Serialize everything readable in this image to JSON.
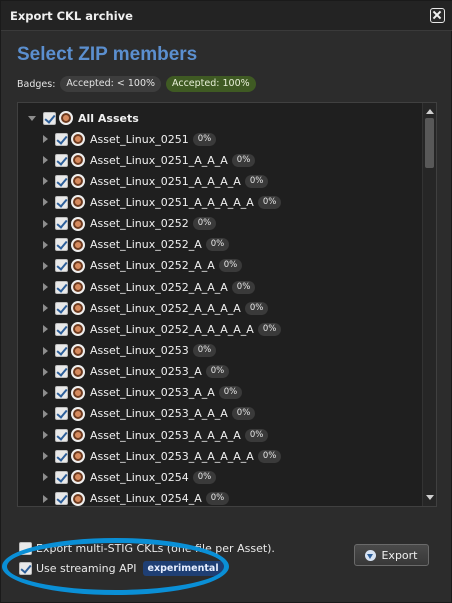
{
  "window": {
    "title": "Export CKL archive"
  },
  "heading": "Select ZIP members",
  "badges": {
    "label": "Badges:",
    "partial": "Accepted: < 100%",
    "full": "Accepted: 100%"
  },
  "tree": {
    "root": {
      "label": "All Assets"
    },
    "items": [
      {
        "label": "Asset_Linux_0251",
        "pct": "0%"
      },
      {
        "label": "Asset_Linux_0251_A_A_A",
        "pct": "0%"
      },
      {
        "label": "Asset_Linux_0251_A_A_A_A",
        "pct": "0%"
      },
      {
        "label": "Asset_Linux_0251_A_A_A_A_A",
        "pct": "0%"
      },
      {
        "label": "Asset_Linux_0252",
        "pct": "0%"
      },
      {
        "label": "Asset_Linux_0252_A",
        "pct": "0%"
      },
      {
        "label": "Asset_Linux_0252_A_A",
        "pct": "0%"
      },
      {
        "label": "Asset_Linux_0252_A_A_A",
        "pct": "0%"
      },
      {
        "label": "Asset_Linux_0252_A_A_A_A",
        "pct": "0%"
      },
      {
        "label": "Asset_Linux_0252_A_A_A_A_A",
        "pct": "0%"
      },
      {
        "label": "Asset_Linux_0253",
        "pct": "0%"
      },
      {
        "label": "Asset_Linux_0253_A",
        "pct": "0%"
      },
      {
        "label": "Asset_Linux_0253_A_A",
        "pct": "0%"
      },
      {
        "label": "Asset_Linux_0253_A_A_A",
        "pct": "0%"
      },
      {
        "label": "Asset_Linux_0253_A_A_A_A",
        "pct": "0%"
      },
      {
        "label": "Asset_Linux_0253_A_A_A_A_A",
        "pct": "0%"
      },
      {
        "label": "Asset_Linux_0254",
        "pct": "0%"
      },
      {
        "label": "Asset_Linux_0254_A",
        "pct": "0%"
      }
    ]
  },
  "options": {
    "multi_stig": {
      "label": "Export multi-STIG CKLs (one file per Asset).",
      "checked": false
    },
    "streaming": {
      "label": "Use streaming API",
      "checked": true,
      "badge": "experimental"
    }
  },
  "export_button": {
    "label": "Export",
    "icon": "download-icon"
  },
  "colors": {
    "heading": "#5b8fcf",
    "badge_full": "#3f5a23",
    "annotation": "#0a8fd6",
    "asset_icon": "#d68b5f"
  }
}
